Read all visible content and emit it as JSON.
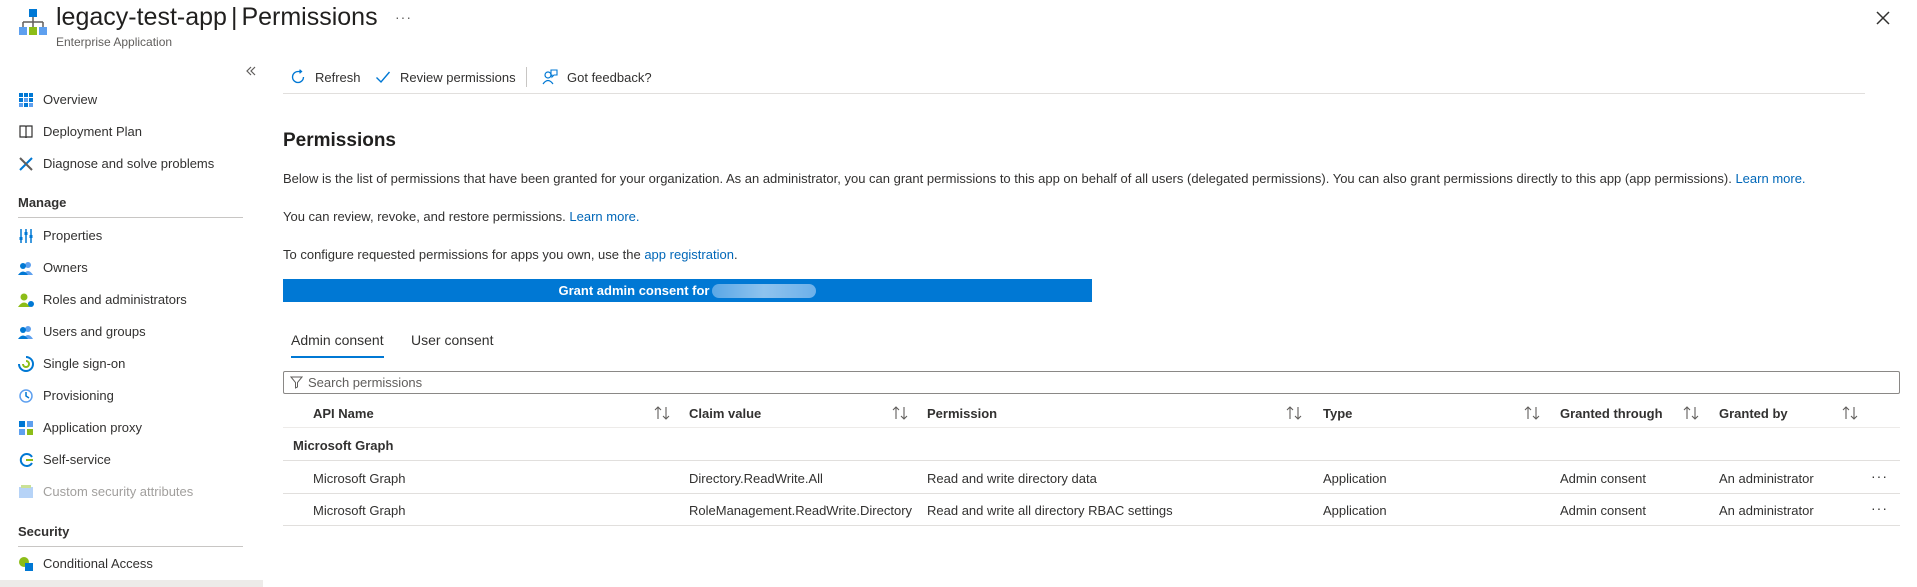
{
  "header": {
    "app_name": "legacy-test-app",
    "separator": "|",
    "page_name": "Permissions",
    "more": "···",
    "subtitle": "Enterprise Application"
  },
  "sidebar": {
    "items_top": [
      {
        "label": "Overview",
        "icon": "overview-grid-icon"
      },
      {
        "label": "Deployment Plan",
        "icon": "book-icon"
      },
      {
        "label": "Diagnose and solve problems",
        "icon": "wrench-cross-icon"
      }
    ],
    "manage_header": "Manage",
    "manage_items": [
      {
        "label": "Properties",
        "icon": "sliders-icon"
      },
      {
        "label": "Owners",
        "icon": "owners-icon"
      },
      {
        "label": "Roles and administrators",
        "icon": "roles-icon"
      },
      {
        "label": "Users and groups",
        "icon": "users-icon"
      },
      {
        "label": "Single sign-on",
        "icon": "sso-icon"
      },
      {
        "label": "Provisioning",
        "icon": "provisioning-icon"
      },
      {
        "label": "Application proxy",
        "icon": "app-proxy-icon"
      },
      {
        "label": "Self-service",
        "icon": "self-service-icon"
      },
      {
        "label": "Custom security attributes",
        "icon": "custom-attributes-icon",
        "disabled": true
      }
    ],
    "security_header": "Security",
    "security_items": [
      {
        "label": "Conditional Access",
        "icon": "conditional-access-icon"
      }
    ]
  },
  "toolbar": {
    "refresh": "Refresh",
    "review": "Review permissions",
    "feedback": "Got feedback?"
  },
  "main": {
    "heading": "Permissions",
    "para1": "Below is the list of permissions that have been granted for your organization. As an administrator, you can grant permissions to this app on behalf of all users (delegated permissions). You can also grant permissions directly to this app (app permissions).",
    "para1_link": "Learn more.",
    "para2": "You can review, revoke, and restore permissions.",
    "para2_link": "Learn more.",
    "para3": "To configure requested permissions for apps you own, use the",
    "para3_link": "app registration",
    "para3_end": ".",
    "grant_button": "Grant admin consent for"
  },
  "tabs": {
    "admin": "Admin consent",
    "user": "User consent"
  },
  "search": {
    "placeholder": "Search permissions"
  },
  "table": {
    "columns": [
      "API Name",
      "Claim value",
      "Permission",
      "Type",
      "Granted through",
      "Granted by"
    ],
    "group": "Microsoft Graph",
    "rows": [
      {
        "api": "Microsoft Graph",
        "claim": "Directory.ReadWrite.All",
        "permission": "Read and write directory data",
        "type": "Application",
        "through": "Admin consent",
        "by": "An administrator",
        "more": "···"
      },
      {
        "api": "Microsoft Graph",
        "claim": "RoleManagement.ReadWrite.Directory",
        "permission": "Read and write all directory RBAC settings",
        "type": "Application",
        "through": "Admin consent",
        "by": "An administrator",
        "more": "···"
      }
    ]
  },
  "colors": {
    "accent": "#0078d4",
    "link": "#0067b8"
  }
}
